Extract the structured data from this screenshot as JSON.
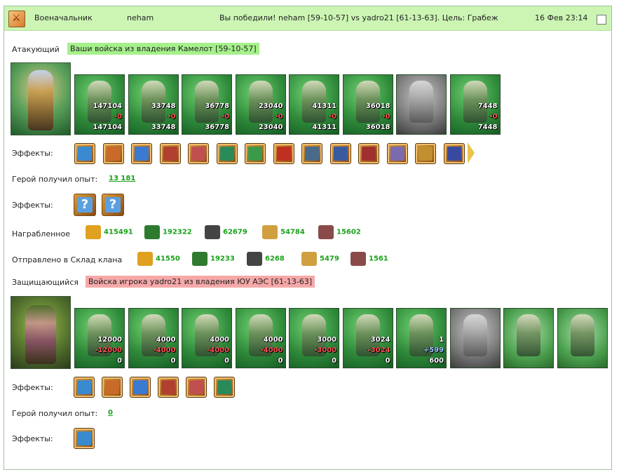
{
  "header": {
    "role": "Военачальник",
    "player": "neham",
    "result": "Вы победили! neham [59-10-57] vs yadro21 [61-13-63]. Цель: Грабеж",
    "date": "16 Фев 23:14"
  },
  "attacker": {
    "label": "Атакующий",
    "army_tag": "Ваши войска из владения Камелот [59-10-57]",
    "units": [
      {
        "top": "147104",
        "mid": "-0",
        "bottom": "147104"
      },
      {
        "top": "33748",
        "mid": "-0",
        "bottom": "33748"
      },
      {
        "top": "36778",
        "mid": "-0",
        "bottom": "36778"
      },
      {
        "top": "23040",
        "mid": "-0",
        "bottom": "23040"
      },
      {
        "top": "41311",
        "mid": "-0",
        "bottom": "41311"
      },
      {
        "top": "36018",
        "mid": "-0",
        "bottom": "36018"
      },
      {
        "top": "",
        "mid": "",
        "bottom": ""
      },
      {
        "top": "7448",
        "mid": "-0",
        "bottom": "7448"
      }
    ],
    "effects_label": "Эффекты:",
    "effects": [
      "sword-icon",
      "handshake-icon",
      "shield-hand-icon",
      "castle-icon",
      "dice-icon",
      "shield-icon",
      "shake-icon",
      "xp-icon",
      "xp-figure-icon",
      "web-icon",
      "armor-icon",
      "ring-icon",
      "sword2-icon",
      "emblem-icon"
    ],
    "xp_label": "Герой получил опыт:",
    "xp_value": "13 181",
    "effects2_label": "Эффекты:",
    "loot_label": "Награбленное",
    "loot": [
      {
        "icon": "gold-icon",
        "value": "415491",
        "color": "#e0a020"
      },
      {
        "icon": "wood-icon",
        "value": "192322",
        "color": "#2e7a2e"
      },
      {
        "icon": "stone-icon",
        "value": "62679",
        "color": "#444444"
      },
      {
        "icon": "food-icon",
        "value": "54784",
        "color": "#d0a040"
      },
      {
        "icon": "iron-icon",
        "value": "15602",
        "color": "#8a4a4a"
      }
    ],
    "sent_label": "Отправлено в Склад клана",
    "sent": [
      {
        "icon": "gold-icon",
        "value": "41550",
        "color": "#e0a020"
      },
      {
        "icon": "wood-icon",
        "value": "19233",
        "color": "#2e7a2e"
      },
      {
        "icon": "stone-icon",
        "value": "6268",
        "color": "#444444"
      },
      {
        "icon": "food-icon",
        "value": "5479",
        "color": "#d0a040"
      },
      {
        "icon": "iron-icon",
        "value": "1561",
        "color": "#8a4a4a"
      }
    ]
  },
  "defender": {
    "label": "Защищающийся",
    "army_tag": "Войска игрока yadro21 из владения ЮУ АЭС [61-13-63]",
    "units": [
      {
        "top": "12000",
        "mid": "-12000",
        "bottom": "0"
      },
      {
        "top": "4000",
        "mid": "-4000",
        "bottom": "0"
      },
      {
        "top": "4000",
        "mid": "-4000",
        "bottom": "0"
      },
      {
        "top": "4000",
        "mid": "-4000",
        "bottom": "0"
      },
      {
        "top": "3000",
        "mid": "-3000",
        "bottom": "0"
      },
      {
        "top": "3024",
        "mid": "-3024",
        "bottom": "0"
      },
      {
        "top": "1",
        "mid": "+599",
        "bottom": "600"
      },
      {
        "top": "",
        "mid": "",
        "bottom": ""
      },
      {
        "top": "",
        "mid": "",
        "bottom": ""
      },
      {
        "top": "",
        "mid": "",
        "bottom": ""
      }
    ],
    "effects_label": "Эффекты:",
    "effects": [
      "door-icon",
      "door-gear-icon",
      "arrow-icon",
      "cross-icon",
      "scroll-icon",
      "globe-shield-icon"
    ],
    "xp_label": "Герой получил опыт:",
    "xp_value": "0",
    "effects2_label": "Эффекты:",
    "effects2": [
      "gate-icon"
    ]
  }
}
